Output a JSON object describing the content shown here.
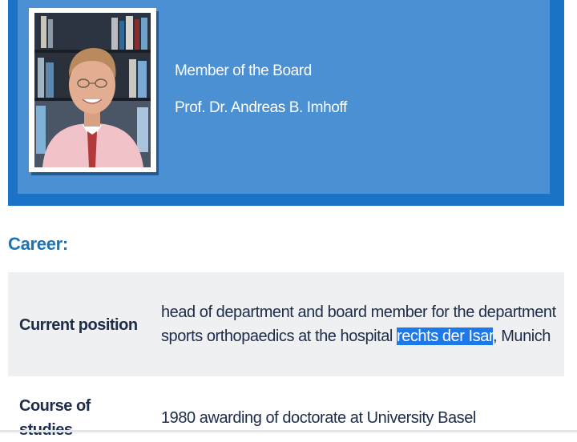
{
  "header": {
    "role": "Member of the Board",
    "name": "Prof. Dr. Andreas B. Imhoff"
  },
  "career": {
    "heading": "Career:",
    "rows": [
      {
        "label": "Current position",
        "value_line1": "head of department and board member for the department",
        "value_line2_before": "sports orthopaedics at the hospital ",
        "value_line2_highlight": "rechts der Isar",
        "value_line2_after": ", Munich"
      },
      {
        "label": "Course of studies",
        "value": "1980 awarding of doctorate at University Basel"
      }
    ]
  },
  "colors": {
    "header_outer": "#1a73c6",
    "header_inner": "#4a90d2",
    "heading_blue": "#1a75b8",
    "text_navy": "#1c2c4a",
    "row_gray": "#eff0f1",
    "selection_highlight": "#1e78e8"
  }
}
